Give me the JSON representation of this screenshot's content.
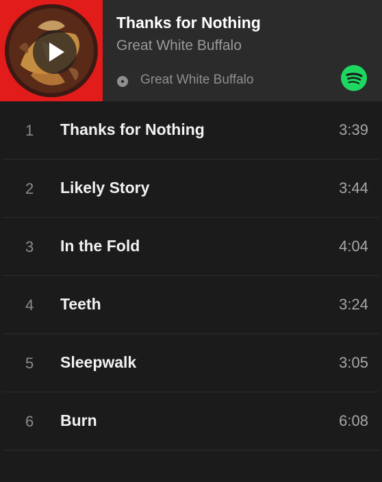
{
  "header": {
    "title": "Thanks for Nothing",
    "artist": "Great White Buffalo",
    "source_label": "Great White Buffalo",
    "cover_icon": "album-cover",
    "play_icon": "play-icon",
    "disc_icon": "disc-icon",
    "service_icon": "spotify-icon"
  },
  "colors": {
    "cover_red": "#e21b1b",
    "spotify_green": "#1ed760"
  },
  "tracks": [
    {
      "number": "1",
      "title": "Thanks for Nothing",
      "duration": "3:39"
    },
    {
      "number": "2",
      "title": "Likely Story",
      "duration": "3:44"
    },
    {
      "number": "3",
      "title": "In the Fold",
      "duration": "4:04"
    },
    {
      "number": "4",
      "title": "Teeth",
      "duration": "3:24"
    },
    {
      "number": "5",
      "title": "Sleepwalk",
      "duration": "3:05"
    },
    {
      "number": "6",
      "title": "Burn",
      "duration": "6:08"
    }
  ]
}
